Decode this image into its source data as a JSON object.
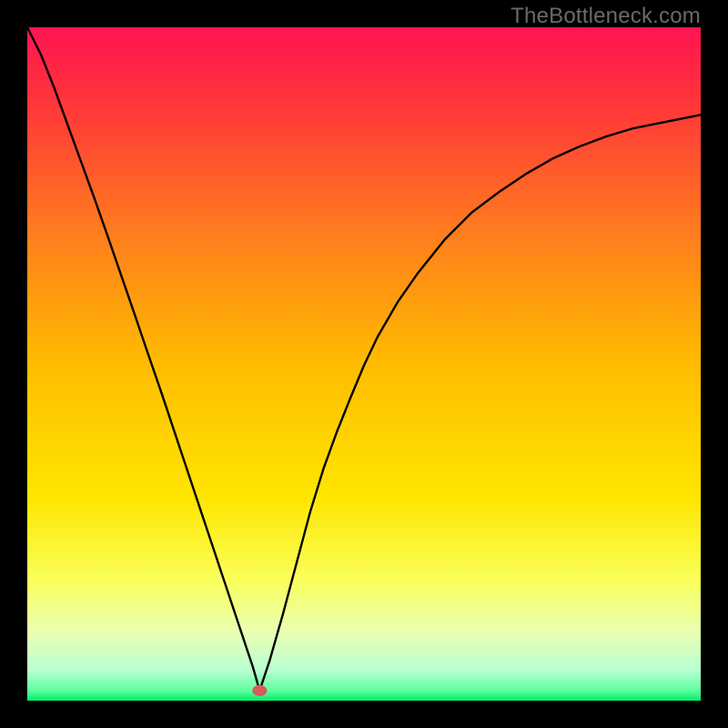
{
  "watermark": "TheBottleneck.com",
  "chart_data": {
    "type": "line",
    "title": "",
    "xlabel": "",
    "ylabel": "",
    "xlim": [
      0,
      1
    ],
    "ylim": [
      0,
      1
    ],
    "grid": false,
    "legend": false,
    "gradient_stops": [
      {
        "offset": 0.0,
        "color": "#ff1452"
      },
      {
        "offset": 0.12,
        "color": "#ff3838"
      },
      {
        "offset": 0.3,
        "color": "#ff7b1f"
      },
      {
        "offset": 0.5,
        "color": "#ffbc00"
      },
      {
        "offset": 0.7,
        "color": "#ffe600"
      },
      {
        "offset": 0.82,
        "color": "#faff5a"
      },
      {
        "offset": 0.9,
        "color": "#e9ffb4"
      },
      {
        "offset": 0.955,
        "color": "#b8ffd0"
      },
      {
        "offset": 0.985,
        "color": "#5eff9e"
      },
      {
        "offset": 1.0,
        "color": "#00ec6a"
      }
    ],
    "minimum_marker": {
      "x": 0.345,
      "y": 0.985,
      "color": "#d85a5a"
    },
    "x": [
      0.0,
      0.02,
      0.04,
      0.06,
      0.08,
      0.1,
      0.12,
      0.14,
      0.16,
      0.18,
      0.2,
      0.22,
      0.24,
      0.26,
      0.28,
      0.3,
      0.32,
      0.335,
      0.345,
      0.36,
      0.38,
      0.4,
      0.42,
      0.44,
      0.46,
      0.48,
      0.5,
      0.52,
      0.55,
      0.58,
      0.62,
      0.66,
      0.7,
      0.74,
      0.78,
      0.82,
      0.86,
      0.9,
      0.94,
      0.98,
      1.0
    ],
    "y": [
      1.0,
      0.96,
      0.91,
      0.855,
      0.8,
      0.745,
      0.688,
      0.63,
      0.572,
      0.513,
      0.455,
      0.395,
      0.335,
      0.275,
      0.215,
      0.155,
      0.095,
      0.05,
      0.015,
      0.06,
      0.13,
      0.205,
      0.28,
      0.345,
      0.4,
      0.45,
      0.498,
      0.54,
      0.592,
      0.635,
      0.685,
      0.725,
      0.755,
      0.782,
      0.805,
      0.823,
      0.838,
      0.85,
      0.858,
      0.866,
      0.87
    ],
    "series": [
      {
        "name": "curve",
        "color": "#000000"
      }
    ]
  }
}
